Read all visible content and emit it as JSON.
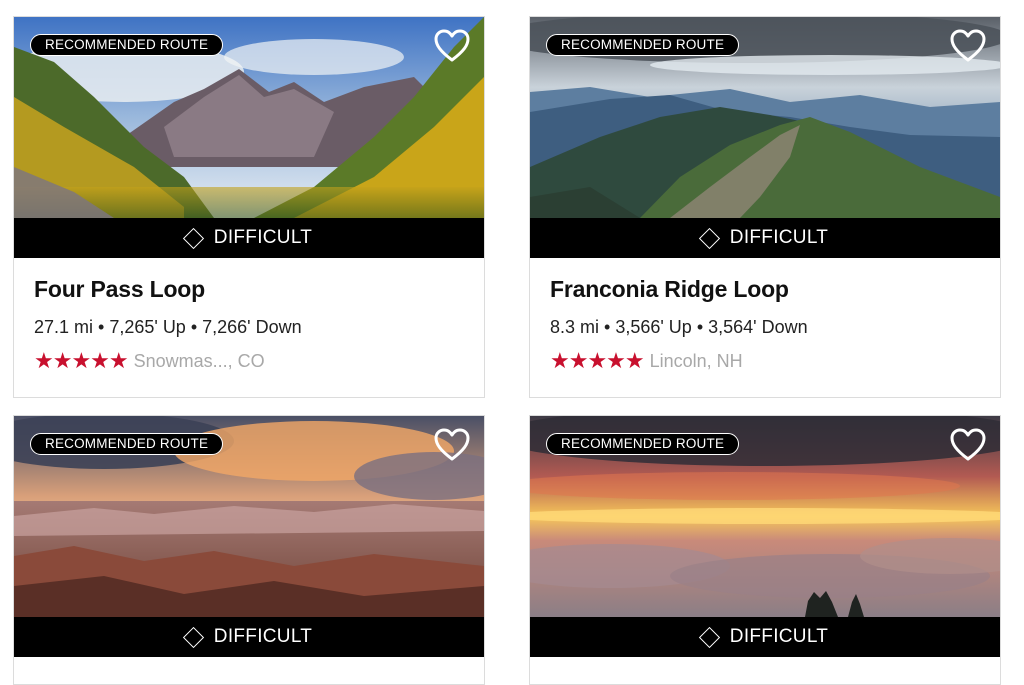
{
  "cards": [
    {
      "badge": "RECOMMENDED ROUTE",
      "difficulty": "DIFFICULT",
      "title": "Four Pass Loop",
      "stats": "27.1 mi • 7,265' Up • 7,266' Down",
      "stars": "★★★★★",
      "rating": 5,
      "location": "Snowmas..., CO",
      "favorite_icon": "heart-outline-icon"
    },
    {
      "badge": "RECOMMENDED ROUTE",
      "difficulty": "DIFFICULT",
      "title": "Franconia Ridge Loop",
      "stats": "8.3 mi • 3,566' Up • 3,564' Down",
      "stars": "★★★★★",
      "rating": 5,
      "location": "Lincoln, NH",
      "favorite_icon": "heart-outline-icon"
    },
    {
      "badge": "RECOMMENDED ROUTE",
      "difficulty": "DIFFICULT",
      "favorite_icon": "heart-outline-icon"
    },
    {
      "badge": "RECOMMENDED ROUTE",
      "difficulty": "DIFFICULT",
      "favorite_icon": "heart-outline-icon"
    }
  ],
  "colors": {
    "star": "#c8102e",
    "location_text": "#a8a8a8",
    "difficulty_bar": "#000000"
  }
}
